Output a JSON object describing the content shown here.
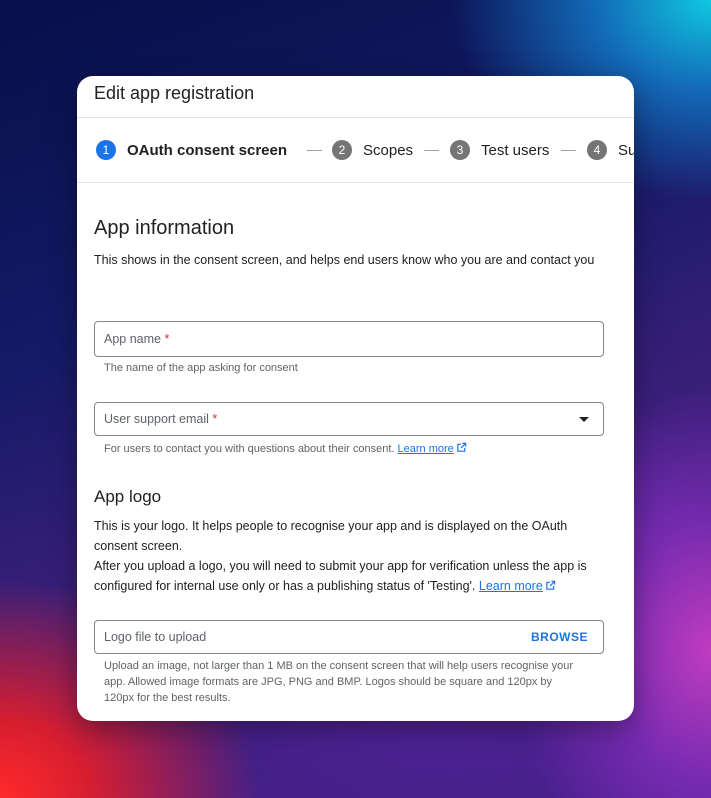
{
  "dialog": {
    "title": "Edit app registration"
  },
  "steps": [
    {
      "num": "1",
      "label": "OAuth consent screen",
      "active": true
    },
    {
      "num": "2",
      "label": "Scopes",
      "active": false
    },
    {
      "num": "3",
      "label": "Test users",
      "active": false
    },
    {
      "num": "4",
      "label": "Summary",
      "active": false
    }
  ],
  "app_info": {
    "title": "App information",
    "description": "This shows in the consent screen, and helps end users know who you are and contact you",
    "app_name": {
      "label": "App name",
      "required_mark": "*",
      "value": "",
      "helper": "The name of the app asking for consent"
    },
    "support_email": {
      "label": "User support email",
      "required_mark": "*",
      "value": "",
      "helper": "For users to contact you with questions about their consent.",
      "link": "Learn more"
    }
  },
  "app_logo": {
    "title": "App logo",
    "description_1": "This is your logo. It helps people to recognise your app and is displayed on the OAuth consent screen.",
    "description_2": "After you upload a logo, you will need to submit your app for verification unless the app is configured for internal use only or has a publishing status of 'Testing'.",
    "link": "Learn more",
    "upload": {
      "placeholder": "Logo file to upload",
      "button": "BROWSE",
      "helper": "Upload an image, not larger than 1 MB on the consent screen that will help users recognise your app. Allowed image formats are JPG, PNG and BMP. Logos should be square and 120px by 120px for the best results."
    }
  },
  "colors": {
    "accent": "#1a73e8",
    "required": "#d93025",
    "inactive_step": "#757575"
  },
  "icons": {
    "external_link": "external-link-icon",
    "dropdown": "dropdown-caret-icon"
  }
}
